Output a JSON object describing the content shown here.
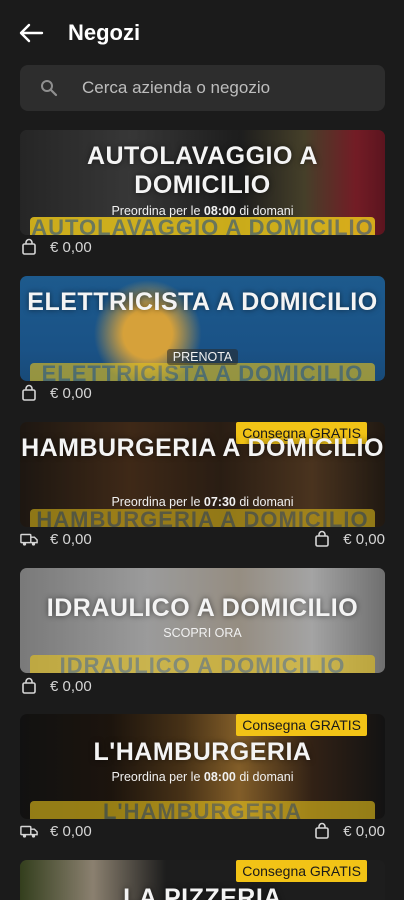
{
  "header": {
    "title": "Negozi"
  },
  "search": {
    "placeholder": "Cerca azienda o negozio"
  },
  "shops": [
    {
      "name": "AUTOLAVAGGIO A DOMICILIO",
      "sub_prefix": "Preordina per le ",
      "sub_time": "08:00",
      "sub_suffix": " di domani",
      "banner_text": "AUTOLAVAGGIO A DOMICILIO",
      "price": "€ 0,00"
    },
    {
      "name": "ELETTRICISTA A DOMICILIO",
      "sub": "PRENOTA",
      "banner_text": "ELETTRICISTA A DOMICILIO",
      "price": "€ 0,00"
    },
    {
      "name": "HAMBURGERIA A DOMICILIO",
      "badge": "Consegna GRATIS",
      "sub_prefix": "Preordina per le ",
      "sub_time": "07:30",
      "sub_suffix": " di domani",
      "banner_text": "HAMBURGERIA A DOMICILIO",
      "delivery_price": "€ 0,00",
      "price": "€ 0,00"
    },
    {
      "name": "IDRAULICO A DOMICILIO",
      "sub": "SCOPRI ORA",
      "banner_text": "IDRAULICO A DOMICILIO",
      "price": "€ 0,00"
    },
    {
      "name": "L'HAMBURGERIA",
      "badge": "Consegna GRATIS",
      "sub_prefix": "Preordina per le ",
      "sub_time": "08:00",
      "sub_suffix": " di domani",
      "banner_text": "L'HAMBURGERIA",
      "delivery_price": "€ 0,00",
      "price": "€ 0,00"
    },
    {
      "name": "LA PIZZERIA",
      "badge": "Consegna GRATIS"
    }
  ],
  "colors": {
    "background": "#1b1b1b",
    "badge": "#f2c316",
    "search_bg": "#2d2d2d"
  },
  "icons": [
    "back-arrow-icon",
    "search-icon",
    "shopping-bag-icon",
    "delivery-truck-icon"
  ]
}
